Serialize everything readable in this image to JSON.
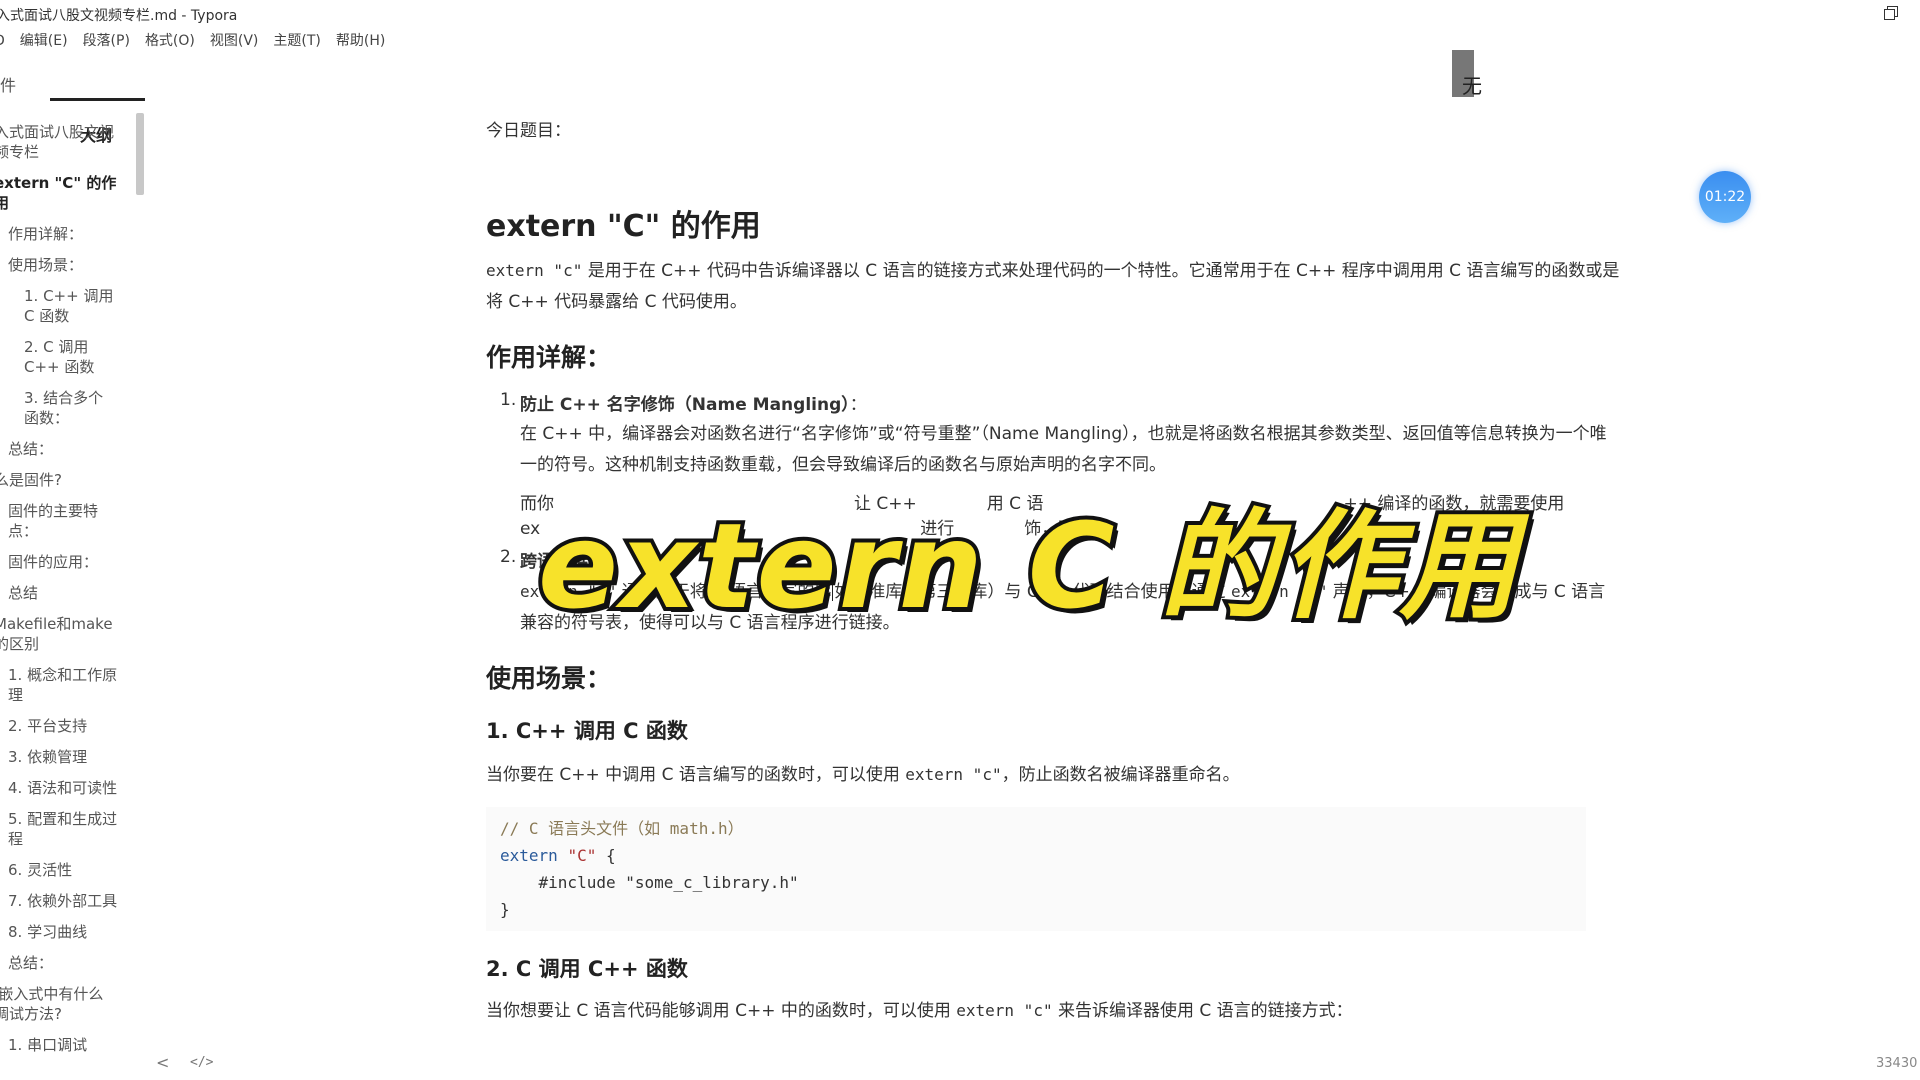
{
  "window": {
    "title": "入式面试八股文视频专栏.md - Typora"
  },
  "menu": [
    "编辑(E)",
    "段落(P)",
    "格式(O)",
    "视图(V)",
    "主题(T)",
    "帮助(H)"
  ],
  "menu_first_fragment": "D",
  "sidebar": {
    "tab_files": "件",
    "tab_outline": "大纲",
    "outline_items": [
      {
        "label": "入式面试八股文视频专栏",
        "level": 1,
        "active": false
      },
      {
        "label": "extern \"C\" 的作用",
        "level": 1,
        "active": true
      },
      {
        "label": "作用详解：",
        "level": 2,
        "active": false
      },
      {
        "label": "使用场景：",
        "level": 2,
        "active": false
      },
      {
        "label": "1. C++ 调用 C 函数",
        "level": 3,
        "active": false
      },
      {
        "label": "2. C 调用 C++ 函数",
        "level": 3,
        "active": false
      },
      {
        "label": "3. 结合多个函数：",
        "level": 3,
        "active": false
      },
      {
        "label": "总结：",
        "level": 2,
        "active": false
      },
      {
        "label": "么是固件?",
        "level": 1,
        "active": false
      },
      {
        "label": "固件的主要特点：",
        "level": 2,
        "active": false
      },
      {
        "label": "固件的应用：",
        "level": 2,
        "active": false
      },
      {
        "label": "总结",
        "level": 2,
        "active": false
      },
      {
        "label": "Makefile和make的区别",
        "level": 1,
        "active": false
      },
      {
        "label": "1. 概念和工作原理",
        "level": 2,
        "active": false
      },
      {
        "label": "2. 平台支持",
        "level": 2,
        "active": false
      },
      {
        "label": "3. 依赖管理",
        "level": 2,
        "active": false
      },
      {
        "label": "4. 语法和可读性",
        "level": 2,
        "active": false
      },
      {
        "label": "5. 配置和生成过程",
        "level": 2,
        "active": false
      },
      {
        "label": "6. 灵活性",
        "level": 2,
        "active": false
      },
      {
        "label": "7. 依赖外部工具",
        "level": 2,
        "active": false
      },
      {
        "label": "8. 学习曲线",
        "level": 2,
        "active": false
      },
      {
        "label": "总结：",
        "level": 2,
        "active": false
      },
      {
        "label": "I嵌入式中有什么调试方法?",
        "level": 1,
        "active": false
      },
      {
        "label": "1. 串口调试",
        "level": 2,
        "active": false
      }
    ],
    "bottom_left": "<",
    "bottom_code": "</>"
  },
  "doc": {
    "intro": "今日题目：",
    "h1": "extern \"C\" 的作用",
    "p1_code": "extern \"c\"",
    "p1_rest": " 是用于在 C++ 代码中告诉编译器以 C 语言的链接方式来处理代码的一个特性。它通常用于在 C++ 程序中调用用 C 语言编写的函数或是将 C++ 代码暴露给 C 代码使用。",
    "h2_detail": "作用详解：",
    "li1_title": "防止 C++ 名字修饰（Name Mangling）",
    "li1_colon": "：",
    "li1_p1": "在 C++ 中，编译器会对函数名进行“名字修饰”或“符号重整”（Name Mangling），也就是将函数名根据其参数类型、返回值等信息转换为一个唯一的符号。这种机制支持函数重载，但会导致编译后的函数名与原始声明的名字不同。",
    "li1_p2_a": "而你",
    "li1_p2_b": "让 C++",
    "li1_p2_c": "用 C 语",
    "li1_p2_d": "++ 编译的函数，就需要使用",
    "li1_p3_a": "ex",
    "li1_p3_b": "进行",
    "li1_p3_c": "饰，而",
    "li2_title": "跨语言链接",
    "li2_colon": "：",
    "li2_code1": "extern \"c\"",
    "li2_p1": " 通常用于将 C 语言编写的库",
    "li2_p1b": "如标准库、第三方库）与 C++ 代码结合使用。通过 ",
    "li2_code2": "extern \"c\"",
    "li2_p1c": " 声明，C++ 编译器会生成与 C 语言兼容的符号表，使得可以与 C 语言程序进行链接。",
    "h2_usage": "使用场景：",
    "h3_1": "1. C++ 调用 C 函数",
    "p_usage1_a": "当你要在 C++ 中调用 C 语言编写的函数时，可以使用 ",
    "p_usage1_code": "extern \"c\"",
    "p_usage1_b": "，防止函数名被编译器重命名。",
    "code_line1": "// C 语言头文件（如 math.h）",
    "code_line2_kw": "extern",
    "code_line2_str": "\"C\"",
    "code_line2_rest": " {",
    "code_line3": "    #include \"some_c_library.h\"",
    "code_line4": "}",
    "h3_2": "2. C 调用 C++ 函数",
    "p_usage2_a": "当你想要让 C 语言代码能够调用 C++ 中的函数时，可以使用 ",
    "p_usage2_code": "extern \"c\"",
    "p_usage2_b": " 来告诉编译器使用 C 语言的链接方式："
  },
  "overlay": {
    "caption": "extern C 的作用",
    "timer": "01:22",
    "gray_mark": "无"
  },
  "status": {
    "word_count": "33430 词"
  }
}
